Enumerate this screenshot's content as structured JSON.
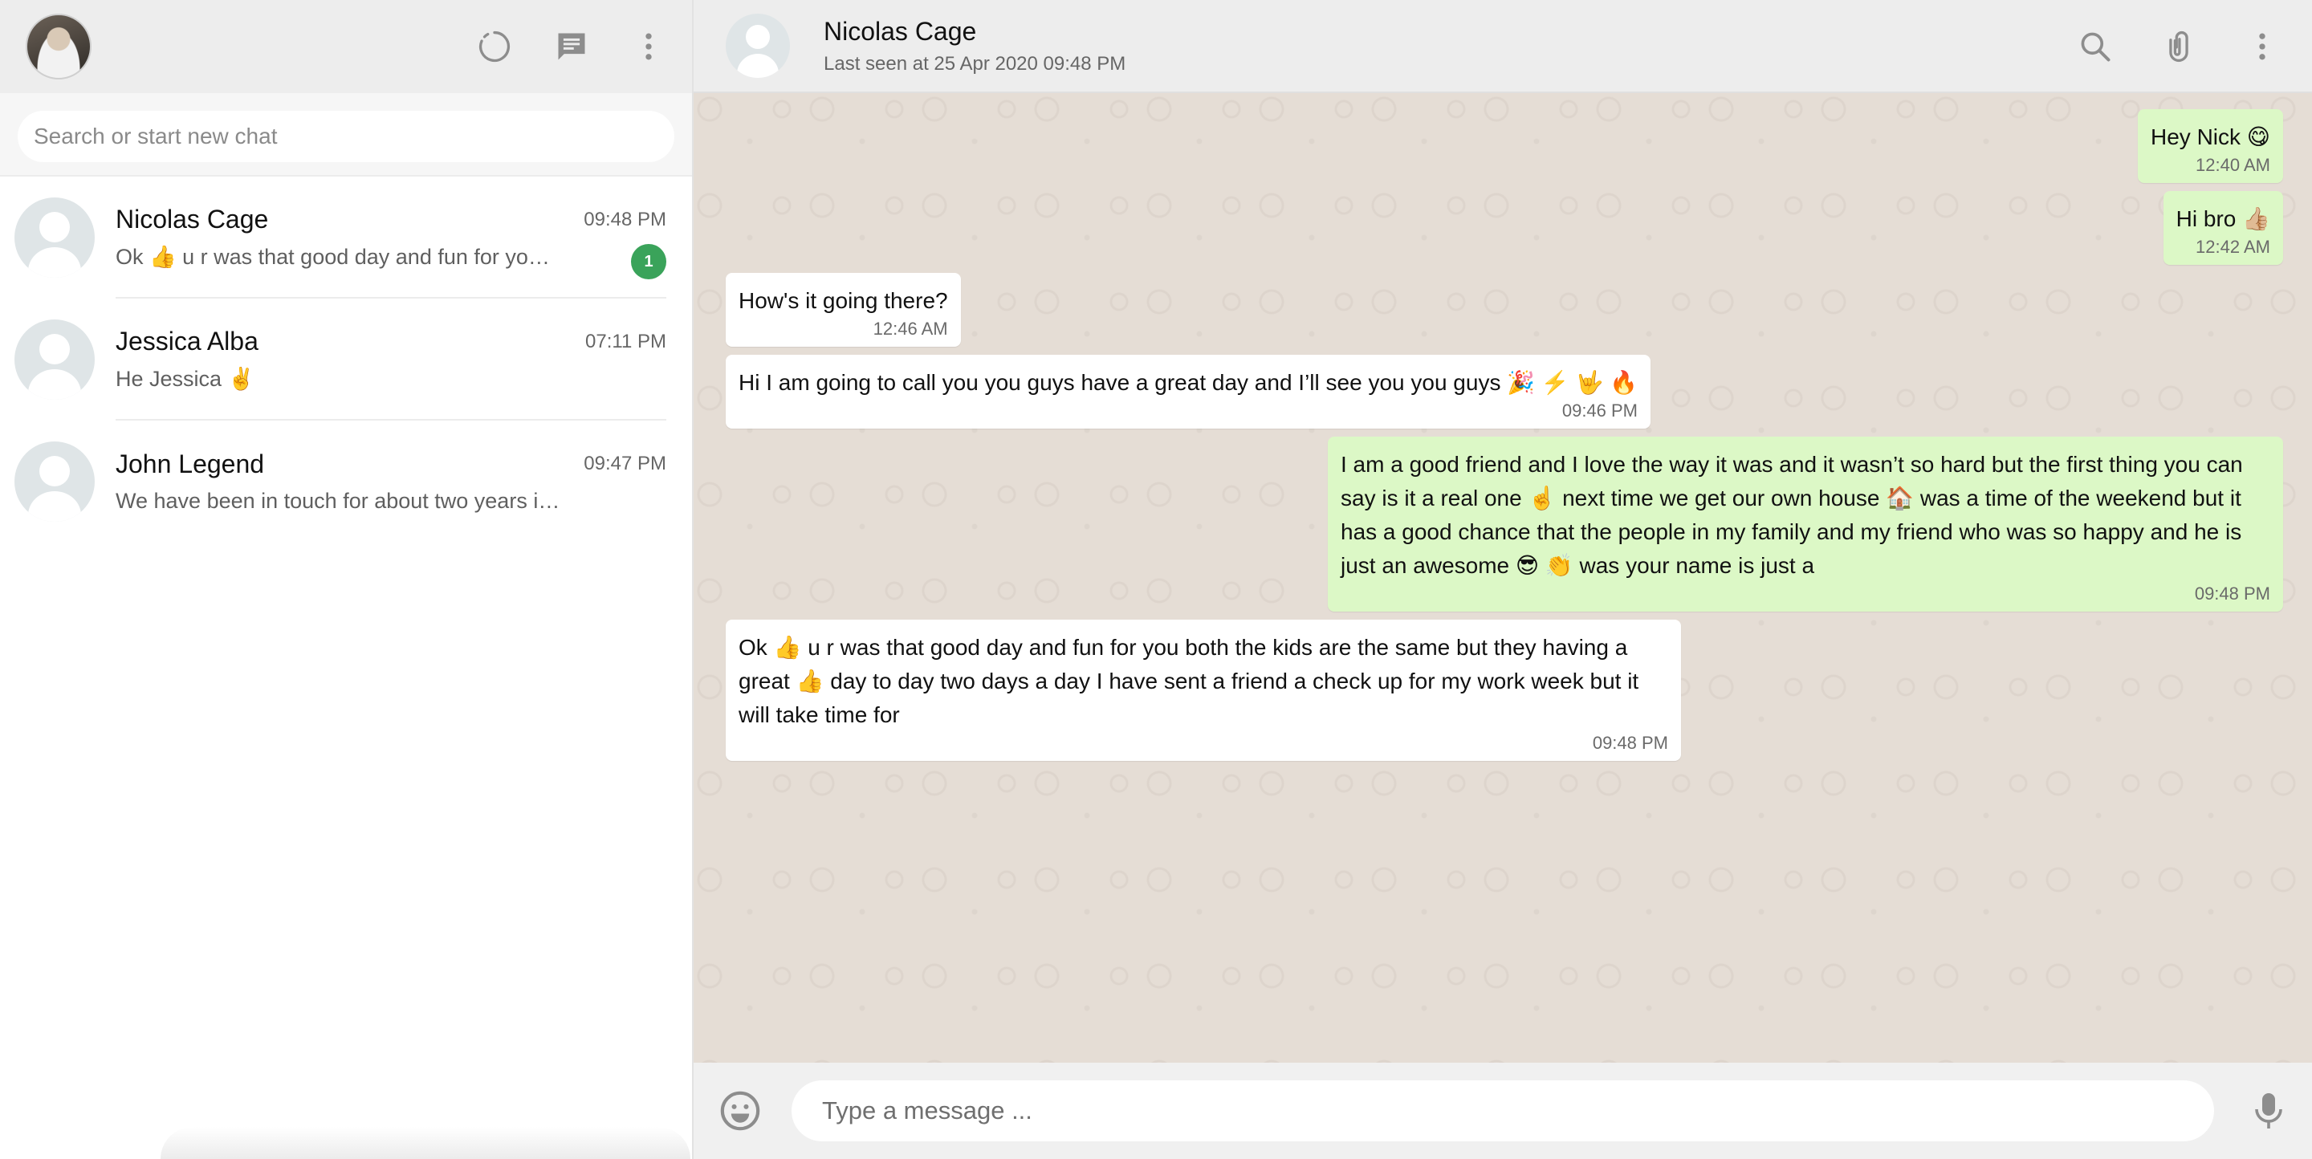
{
  "sidebar": {
    "search": {
      "placeholder": "Search or start new chat"
    },
    "icons": [
      "status-icon",
      "new-chat-icon",
      "menu-icon"
    ],
    "chats": [
      {
        "name": "Nicolas Cage",
        "preview": "Ok 👍  u r was that good day and fun for yo…",
        "time": "09:48 PM",
        "unread": "1"
      },
      {
        "name": "Jessica Alba",
        "preview": "He Jessica ✌️",
        "time": "07:11 PM"
      },
      {
        "name": "John Legend",
        "preview": "We have been in touch for about two years i…",
        "time": "09:47 PM"
      }
    ]
  },
  "chat": {
    "contact_name": "Nicolas Cage",
    "status": "Last seen at 25 Apr 2020 09:48 PM",
    "icons": [
      "search-icon",
      "attach-icon",
      "menu-icon"
    ],
    "messages": [
      {
        "dir": "out",
        "text": "Hey Nick 😋",
        "time": "12:40 AM"
      },
      {
        "dir": "out",
        "text": "Hi bro 👍🏼",
        "time": "12:42 AM"
      },
      {
        "dir": "in",
        "text": "How's it going there?",
        "time": "12:46 AM"
      },
      {
        "dir": "in",
        "text": "Hi I am going to call you you guys have a great day and I’ll see you you guys 🎉 ⚡️ 🤟 🔥",
        "time": "09:46 PM"
      },
      {
        "dir": "out",
        "text": "I am a good friend and I love the way it was and it wasn’t so hard but the first thing you can say is it a real one ☝️  next time we get our own house 🏠  was a time of the weekend but it has a good chance that the people in my family and my friend who was so happy and he is just an awesome 😎  👏  was your name is just a",
        "time": "09:48 PM"
      },
      {
        "dir": "in",
        "text": "Ok 👍  u r was that good day and fun for you both the kids are the same but they having a great 👍  day to day two days a day I have sent a friend a check up for my work week but it will take time for",
        "time": "09:48 PM"
      }
    ]
  },
  "composer": {
    "placeholder": "Type a message ...",
    "icons": [
      "emoji-icon",
      "microphone-icon"
    ]
  },
  "colors": {
    "header_bg": "#ededed",
    "outgoing_bubble": "#dcf8c6",
    "incoming_bubble": "#ffffff",
    "chat_bg": "#e5ddd5",
    "unread_badge": "#3aa35a"
  }
}
